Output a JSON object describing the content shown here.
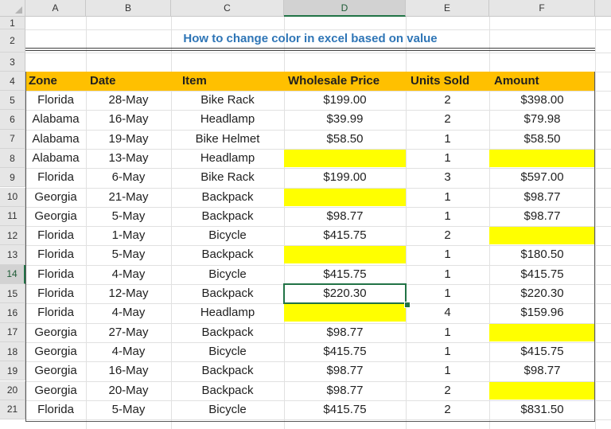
{
  "columns": [
    "A",
    "B",
    "C",
    "D",
    "E",
    "F"
  ],
  "row_numbers": [
    "1",
    "2",
    "3",
    "4",
    "5",
    "6",
    "7",
    "8",
    "9",
    "10",
    "11",
    "12",
    "13",
    "14",
    "15",
    "16",
    "17",
    "18",
    "19",
    "20",
    "21"
  ],
  "selected_column": "D",
  "selected_row": "14",
  "title": "How to change color in excel based on value",
  "headers": {
    "zone": "Zone",
    "date": "Date",
    "item": "Item",
    "wholesale_price": "Wholesale Price",
    "units_sold": "Units Sold",
    "amount": "Amount"
  },
  "rows": [
    {
      "zone": "Florida",
      "date": "28-May",
      "item": "Bike Rack",
      "price": "$199.00",
      "units": "2",
      "amount": "$398.00"
    },
    {
      "zone": "Alabama",
      "date": "16-May",
      "item": "Headlamp",
      "price": "$39.99",
      "units": "2",
      "amount": "$79.98"
    },
    {
      "zone": "Alabama",
      "date": "19-May",
      "item": "Bike Helmet",
      "price": "$58.50",
      "units": "1",
      "amount": "$58.50"
    },
    {
      "zone": "Alabama",
      "date": "13-May",
      "item": "Headlamp",
      "price": "",
      "units": "1",
      "amount": ""
    },
    {
      "zone": "Florida",
      "date": "6-May",
      "item": "Bike Rack",
      "price": "$199.00",
      "units": "3",
      "amount": "$597.00"
    },
    {
      "zone": "Georgia",
      "date": "21-May",
      "item": "Backpack",
      "price": "",
      "units": "1",
      "amount": "$98.77"
    },
    {
      "zone": "Georgia",
      "date": "5-May",
      "item": "Backpack",
      "price": "$98.77",
      "units": "1",
      "amount": "$98.77"
    },
    {
      "zone": "Florida",
      "date": "1-May",
      "item": "Bicycle",
      "price": "$415.75",
      "units": "2",
      "amount": ""
    },
    {
      "zone": "Florida",
      "date": "5-May",
      "item": "Backpack",
      "price": "",
      "units": "1",
      "amount": "$180.50"
    },
    {
      "zone": "Florida",
      "date": "4-May",
      "item": "Bicycle",
      "price": "$415.75",
      "units": "1",
      "amount": "$415.75"
    },
    {
      "zone": "Florida",
      "date": "12-May",
      "item": "Backpack",
      "price": "$220.30",
      "units": "1",
      "amount": "$220.30"
    },
    {
      "zone": "Florida",
      "date": "4-May",
      "item": "Headlamp",
      "price": "",
      "units": "4",
      "amount": "$159.96"
    },
    {
      "zone": "Georgia",
      "date": "27-May",
      "item": "Backpack",
      "price": "$98.77",
      "units": "1",
      "amount": ""
    },
    {
      "zone": "Georgia",
      "date": "4-May",
      "item": "Bicycle",
      "price": "$415.75",
      "units": "1",
      "amount": "$415.75"
    },
    {
      "zone": "Georgia",
      "date": "16-May",
      "item": "Backpack",
      "price": "$98.77",
      "units": "1",
      "amount": "$98.77"
    },
    {
      "zone": "Georgia",
      "date": "20-May",
      "item": "Backpack",
      "price": "$98.77",
      "units": "2",
      "amount": ""
    },
    {
      "zone": "Florida",
      "date": "5-May",
      "item": "Bicycle",
      "price": "$415.75",
      "units": "2",
      "amount": "$831.50"
    }
  ],
  "colors": {
    "header_fill": "#ffc000",
    "blank_highlight": "#ffff00",
    "title_text": "#2e75b6",
    "selection": "#217346"
  }
}
